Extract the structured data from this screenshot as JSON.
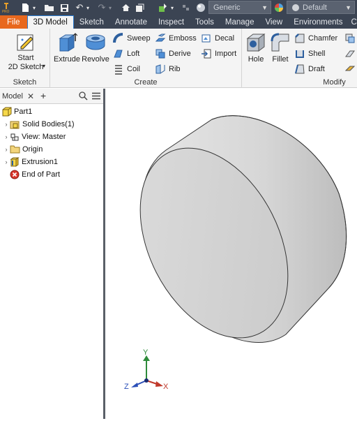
{
  "quick_access": {
    "material_value": "Generic",
    "appearance_value": "Default"
  },
  "tabs": [
    {
      "label": "File"
    },
    {
      "label": "3D Model"
    },
    {
      "label": "Sketch"
    },
    {
      "label": "Annotate"
    },
    {
      "label": "Inspect"
    },
    {
      "label": "Tools"
    },
    {
      "label": "Manage"
    },
    {
      "label": "View"
    },
    {
      "label": "Environments"
    },
    {
      "label": "C"
    }
  ],
  "ribbon": {
    "sketch_panel": {
      "label": "Sketch",
      "start_sketch": "Start\n2D Sketch"
    },
    "create_panel": {
      "label": "Create",
      "extrude": "Extrude",
      "revolve": "Revolve",
      "sweep": "Sweep",
      "loft": "Loft",
      "coil": "Coil",
      "emboss": "Emboss",
      "derive": "Derive",
      "rib": "Rib",
      "decal": "Decal",
      "import": "Import"
    },
    "modify_panel": {
      "label": "Modify",
      "hole": "Hole",
      "fillet": "Fillet",
      "chamfer": "Chamfer",
      "shell": "Shell",
      "draft": "Draft"
    }
  },
  "browser": {
    "tab_label": "Model",
    "tree": [
      {
        "label": "Part1"
      },
      {
        "label": "Solid Bodies(1)"
      },
      {
        "label": "View: Master"
      },
      {
        "label": "Origin"
      },
      {
        "label": "Extrusion1"
      },
      {
        "label": "End of Part"
      }
    ]
  },
  "viewcube_axes": {
    "x": "X",
    "y": "Y",
    "z": "Z"
  },
  "colors": {
    "titlebar": "#3b4453",
    "file_tab": "#e8681e",
    "accent": "#2b7bd0"
  }
}
